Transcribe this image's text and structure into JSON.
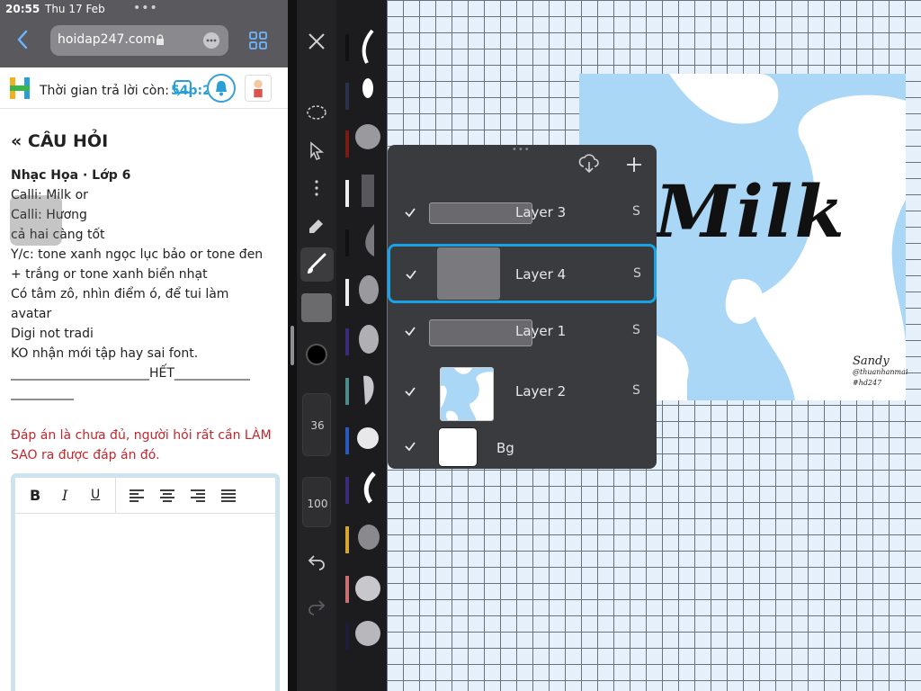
{
  "status": {
    "time": "20:55",
    "date": "Thu 17 Feb",
    "dots": "•••"
  },
  "browser": {
    "url": "hoidap247.com"
  },
  "site": {
    "timer_label": "Thời gian trả lời còn:",
    "timer_value": "54p:29s"
  },
  "question": {
    "title": "CÂU HỎI",
    "subject": "Nhạc Họa · Lớp 6",
    "lines": [
      "Calli: Milk or",
      "Calli: Hương",
      "cả hai càng tốt",
      "Y/c: tone xanh ngọc lục bảo or tone đen",
      "+ trắng or tone xanh biển nhạt",
      "Có tâm zô, nhìn điểm ó, để tui làm",
      "avatar",
      "Digi not tradi",
      "KO nhận mới tập hay sai font.",
      "______________________HẾT____________",
      "__________"
    ],
    "warning": "Đáp án là chưa đủ, người hỏi rất cần LÀM SAO ra được đáp án đó."
  },
  "editor": {
    "bold": "B",
    "italic": "I",
    "underline": "U"
  },
  "procreate": {
    "brush_size": "36",
    "opacity": "100",
    "artwork_text": "Milk",
    "signature": "Sandy",
    "signature_handle": "@thuanhanmai",
    "signature_tag": "#hd247",
    "layers": [
      {
        "name": "Layer 3",
        "blend": "S"
      },
      {
        "name": "Layer 4",
        "blend": "S"
      },
      {
        "name": "Layer 1",
        "blend": "S"
      },
      {
        "name": "Layer 2",
        "blend": "S"
      },
      {
        "name": "Bg"
      }
    ]
  },
  "colors": {
    "accent": "#19a3e6",
    "warning": "#c0272d",
    "artwork_bg": "#aad7f6"
  }
}
